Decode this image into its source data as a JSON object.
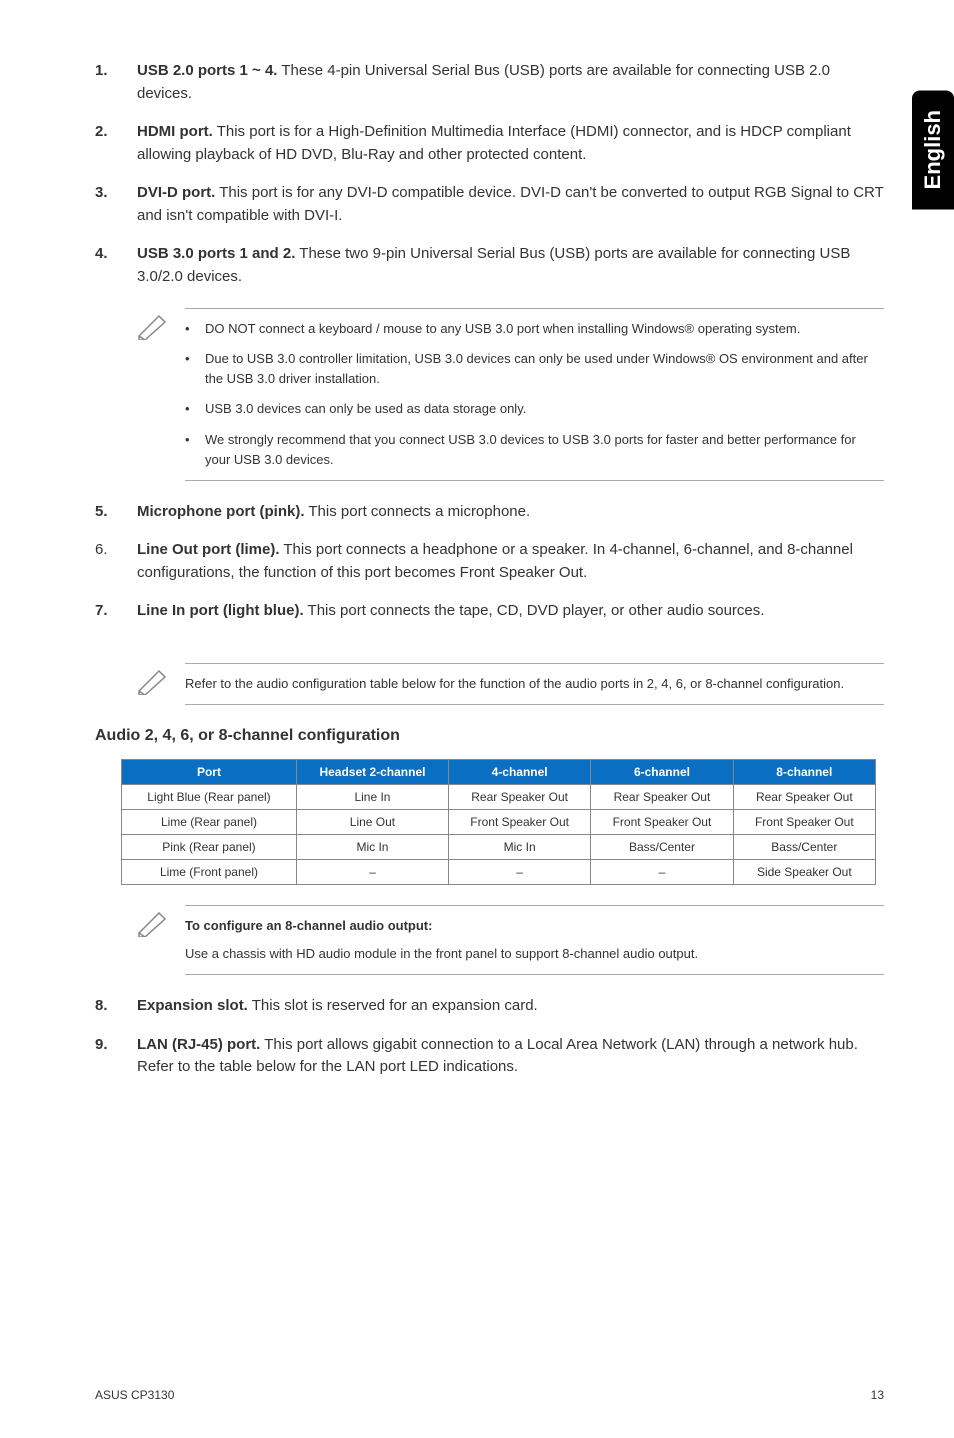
{
  "sidebar_lang": "English",
  "items": [
    {
      "num": "1.",
      "bold": "USB 2.0 ports 1 ~ 4.",
      "text": " These 4-pin Universal Serial Bus (USB) ports are available for connecting USB 2.0 devices."
    },
    {
      "num": "2.",
      "bold": "HDMI port.",
      "text": " This port is for a High-Definition Multimedia Interface (HDMI) connector, and is HDCP compliant allowing playback of HD DVD, Blu-Ray and other protected content."
    },
    {
      "num": "3.",
      "bold": "DVI-D port.",
      "text": " This port is for any DVI-D compatible device. DVI-D can't be converted to output RGB Signal to CRT and isn't compatible with DVI-I."
    },
    {
      "num": "4.",
      "bold": "USB 3.0 ports 1 and 2.",
      "text": " These two 9-pin Universal Serial Bus (USB) ports are available for connecting USB 3.0/2.0 devices."
    }
  ],
  "note1": [
    "DO NOT connect a keyboard / mouse to any USB 3.0 port when installing Windows® operating system.",
    "Due to USB 3.0 controller limitation, USB 3.0 devices can only be used under Windows® OS environment and after the USB 3.0 driver installation.",
    "USB 3.0 devices can only be used as data storage only.",
    "We strongly recommend that you connect USB 3.0 devices to USB 3.0 ports for faster and better performance for your USB 3.0 devices."
  ],
  "items2": [
    {
      "num": "5.",
      "bold": "Microphone port (pink).",
      "text": " This port connects a microphone."
    },
    {
      "num": "6.",
      "bold": "Line Out port (lime).",
      "text": " This port connects a headphone or a speaker. In 4-channel, 6-channel, and 8-channel configurations, the function of this port becomes Front Speaker Out.",
      "num_regular": true
    },
    {
      "num": "7.",
      "bold": "Line In port (light blue).",
      "text": " This port connects the tape, CD, DVD player, or other audio sources."
    }
  ],
  "note2": "Refer to the audio configuration table below for the function of the audio ports in 2, 4, 6, or 8-channel configuration.",
  "audio_title": "Audio 2, 4, 6, or 8-channel configuration",
  "table": {
    "headers": [
      "Port",
      "Headset 2-channel",
      "4-channel",
      "6-channel",
      "8-channel"
    ],
    "rows": [
      [
        "Light Blue (Rear panel)",
        "Line In",
        "Rear Speaker Out",
        "Rear Speaker Out",
        "Rear Speaker Out"
      ],
      [
        "Lime (Rear panel)",
        "Line Out",
        "Front Speaker Out",
        "Front Speaker Out",
        "Front Speaker Out"
      ],
      [
        "Pink (Rear panel)",
        "Mic In",
        "Mic In",
        "Bass/Center",
        "Bass/Center"
      ],
      [
        "Lime (Front panel)",
        "–",
        "–",
        "–",
        "Side Speaker Out"
      ]
    ]
  },
  "note3": {
    "title": "To configure an 8-channel audio output:",
    "body": "Use a chassis with HD audio module in the front panel to support 8-channel audio output."
  },
  "items3": [
    {
      "num": "8.",
      "bold": "Expansion slot.",
      "text": " This slot is reserved for an expansion card."
    },
    {
      "num": "9.",
      "bold": "LAN (RJ-45) port.",
      "text": " This port allows gigabit connection to a Local Area Network (LAN) through a network hub. Refer to the table below for the LAN port LED indications."
    }
  ],
  "footer": {
    "left": "ASUS CP3130",
    "right": "13"
  }
}
